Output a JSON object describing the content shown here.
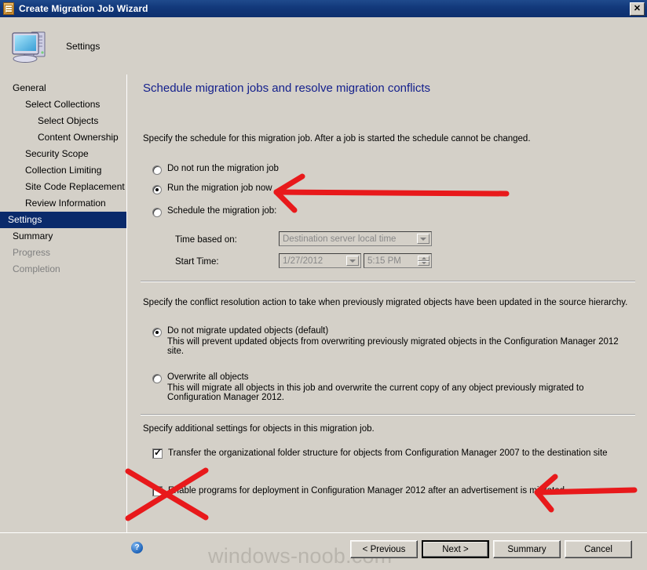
{
  "window": {
    "title": "Create Migration Job Wizard",
    "icon": "clipboard-icon",
    "close_label": "✕"
  },
  "header": {
    "title": "Settings",
    "icon": "computer-icon"
  },
  "sidebar": {
    "items": [
      {
        "label": "General",
        "indent": 0,
        "state": "normal"
      },
      {
        "label": "Select Collections",
        "indent": 1,
        "state": "normal"
      },
      {
        "label": "Select Objects",
        "indent": 2,
        "state": "normal"
      },
      {
        "label": "Content Ownership",
        "indent": 2,
        "state": "normal"
      },
      {
        "label": "Security Scope",
        "indent": 1,
        "state": "normal"
      },
      {
        "label": "Collection Limiting",
        "indent": 1,
        "state": "normal"
      },
      {
        "label": "Site Code Replacement",
        "indent": 1,
        "state": "normal"
      },
      {
        "label": "Review Information",
        "indent": 1,
        "state": "normal"
      },
      {
        "label": "Settings",
        "indent": 0,
        "state": "selected"
      },
      {
        "label": "Summary",
        "indent": 0,
        "state": "normal"
      },
      {
        "label": "Progress",
        "indent": 0,
        "state": "disabled"
      },
      {
        "label": "Completion",
        "indent": 0,
        "state": "disabled"
      }
    ]
  },
  "page": {
    "heading": "Schedule migration jobs and resolve migration conflicts",
    "schedule": {
      "instruction": "Specify the schedule for this migration job. After a job is started the schedule cannot be changed.",
      "options": [
        {
          "label": "Do not run the migration job",
          "selected": false
        },
        {
          "label": "Run the migration job now",
          "selected": true
        },
        {
          "label": "Schedule the migration job:",
          "selected": false
        }
      ],
      "fields": [
        {
          "label": "Time based on:",
          "value": "Destination server local time",
          "enabled": false
        },
        {
          "label": "Start Time:",
          "date_value": "1/27/2012",
          "time_value": "5:15 PM",
          "enabled": false
        }
      ]
    },
    "conflict": {
      "instruction": "Specify the conflict resolution action to take when previously migrated objects have been updated in the source hierarchy.",
      "options": [
        {
          "label": "Do not migrate updated objects  (default)",
          "description": "This will prevent updated objects from overwriting previously migrated objects in the Configuration Manager 2012 site.",
          "selected": true
        },
        {
          "label": "Overwrite all objects",
          "description": "This will migrate all objects in this job and overwrite the current copy of any object previously migrated to Configuration Manager 2012.",
          "selected": false
        }
      ]
    },
    "additional": {
      "instruction": "Specify additional settings for objects in this migration job.",
      "checkboxes": [
        {
          "label": "Transfer the organizational folder structure for objects from Configuration Manager 2007 to the destination site",
          "checked": true
        },
        {
          "label": "Enable programs for deployment in Configuration Manager 2012 after an advertisement is migrated",
          "checked": false
        }
      ]
    }
  },
  "footer": {
    "help_icon": "help-icon",
    "help_glyph": "?",
    "watermark": "windows-noob.com",
    "buttons": [
      {
        "label": "< Previous",
        "default": false
      },
      {
        "label": "Next >",
        "default": true
      },
      {
        "label": "Summary",
        "default": false
      },
      {
        "label": "Cancel",
        "default": false
      }
    ]
  },
  "annotations": {
    "color": "#e8191b",
    "arrow_top": "arrow-pointing-to-run-now-option",
    "arrow_bottom": "arrow-pointing-to-enable-programs-checkbox",
    "cross": "red-x-over-enable-programs-checkbox"
  }
}
